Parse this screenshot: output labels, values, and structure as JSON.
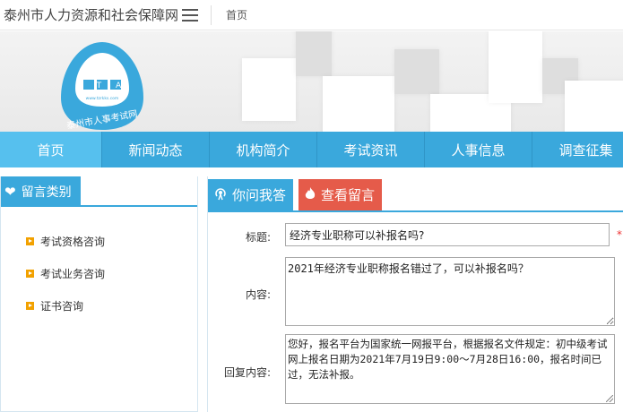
{
  "header": {
    "site_title": "泰州市人力资源和社会保障网",
    "home_link": "首页"
  },
  "logo": {
    "letters": "P T A",
    "url_text": "www.tzrkks.com",
    "name": "泰州市人事考试网",
    "colors": {
      "primary": "#3aa8dc",
      "ring": "#ffffff"
    }
  },
  "nav": {
    "items": [
      {
        "label": "首页",
        "active": true
      },
      {
        "label": "新闻动态"
      },
      {
        "label": "机构简介"
      },
      {
        "label": "考试资讯"
      },
      {
        "label": "人事信息"
      },
      {
        "label": "调查征集"
      }
    ]
  },
  "sidebar": {
    "title": "留言类别",
    "icon": "heart-icon",
    "items": [
      {
        "label": "考试资格咨询"
      },
      {
        "label": "考试业务咨询"
      },
      {
        "label": "证书咨询"
      }
    ]
  },
  "main": {
    "tabs": [
      {
        "label": "你问我答",
        "icon": "broadcast-icon",
        "color": "#3aa8dc"
      },
      {
        "label": "查看留言",
        "icon": "flame-icon",
        "color": "#e55b4a"
      }
    ],
    "form": {
      "title_label": "标题:",
      "title_value": "经济专业职称可以补报名吗?",
      "required_mark": "*",
      "content_label": "内容:",
      "content_value": "2021年经济专业职称报名错过了，可以补报名吗？",
      "reply_label": "回复内容:",
      "reply_value": "您好，报名平台为国家统一网报平台，根据报名文件规定：初中级考试网上报名日期为2021年7月19日9:00～7月28日16:00，报名时间已过，无法补报。"
    }
  }
}
